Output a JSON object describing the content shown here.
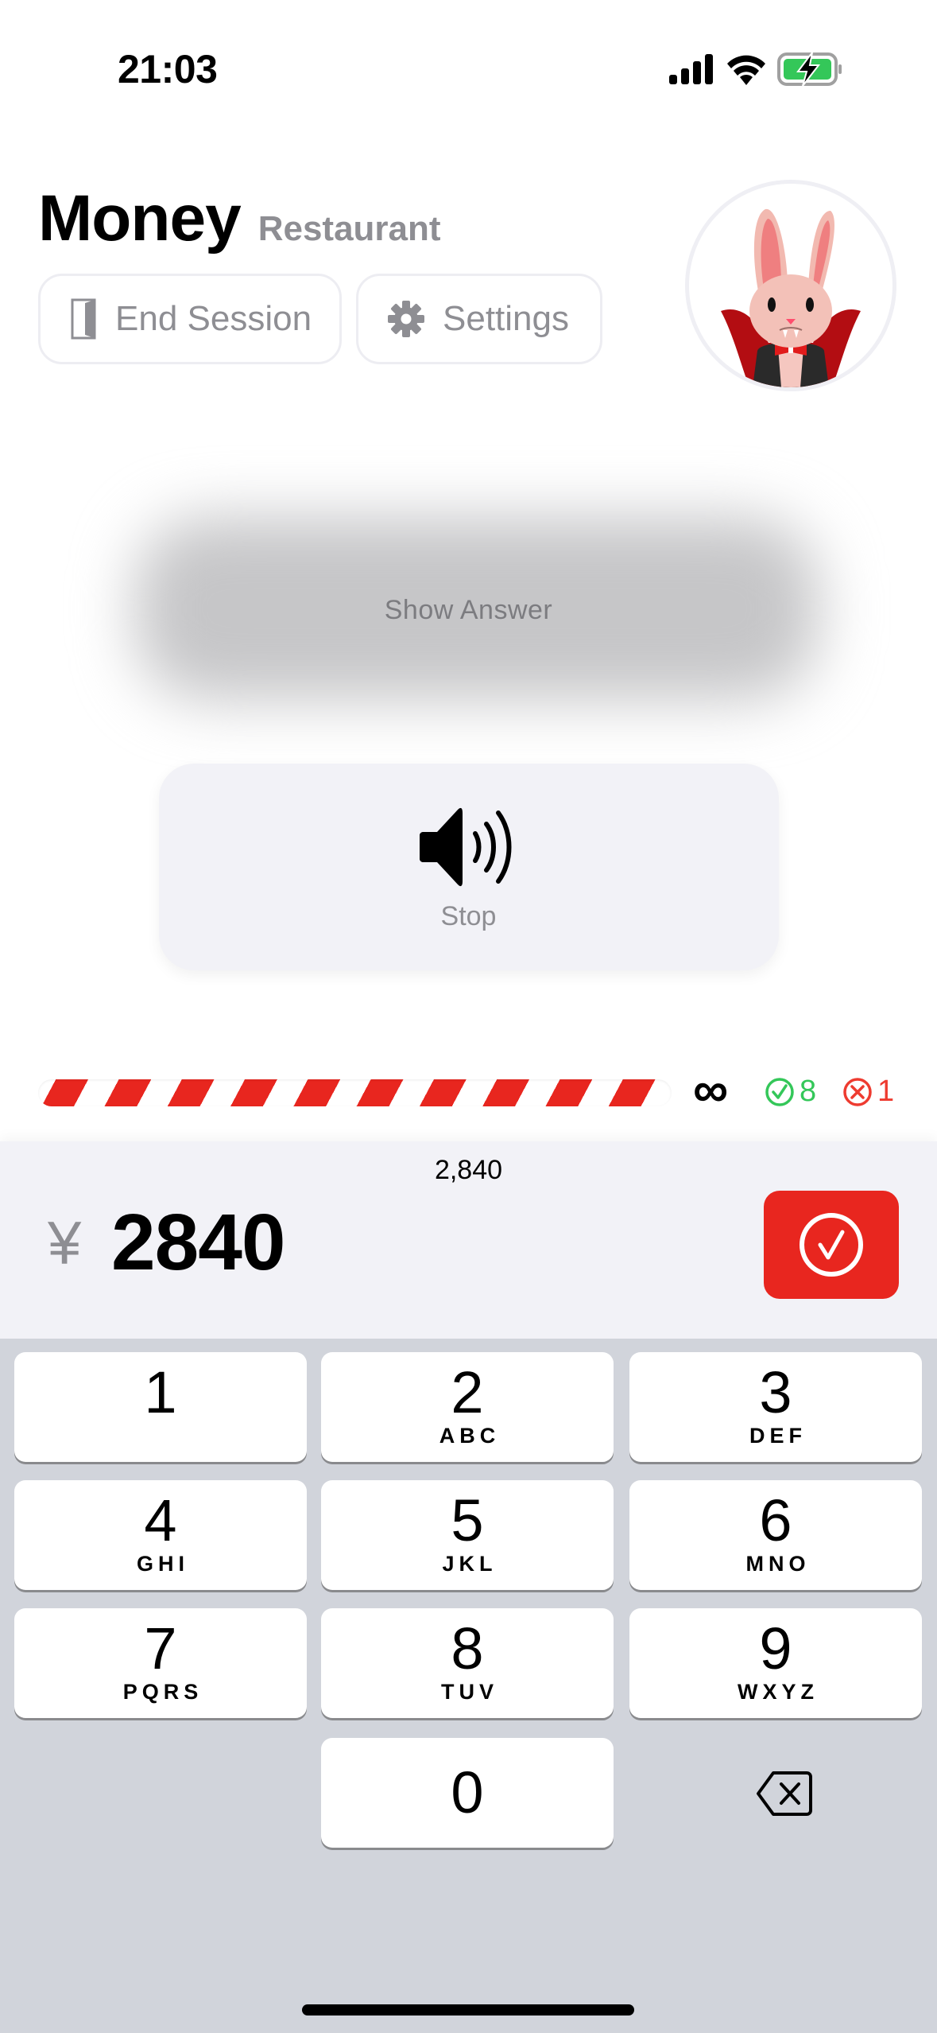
{
  "status_bar": {
    "time": "21:03",
    "battery_color": "#34c759"
  },
  "header": {
    "title": "Money",
    "subtitle": "Restaurant",
    "end_session_label": "End Session",
    "settings_label": "Settings",
    "avatar": "vampire-bunny-avatar"
  },
  "answer": {
    "show_answer_label": "Show Answer"
  },
  "audio": {
    "stop_label": "Stop",
    "icon": "speaker-wave-icon"
  },
  "progress": {
    "fraction": 1.0,
    "remaining": "∞",
    "correct_count": "8",
    "wrong_count": "1",
    "colors": {
      "stripe": "#e8261f",
      "correct": "#34c759",
      "wrong": "#ee3b30"
    }
  },
  "input": {
    "formatted_value": "2,840",
    "currency_symbol": "¥",
    "value": "2840",
    "confirm_color": "#e8261f"
  },
  "keypad": {
    "keys": [
      {
        "num": "1",
        "letters": ""
      },
      {
        "num": "2",
        "letters": "ABC"
      },
      {
        "num": "3",
        "letters": "DEF"
      },
      {
        "num": "4",
        "letters": "GHI"
      },
      {
        "num": "5",
        "letters": "JKL"
      },
      {
        "num": "6",
        "letters": "MNO"
      },
      {
        "num": "7",
        "letters": "PQRS"
      },
      {
        "num": "8",
        "letters": "TUV"
      },
      {
        "num": "9",
        "letters": "WXYZ"
      },
      {
        "num": "0",
        "letters": ""
      }
    ],
    "backspace_icon": "delete-left-icon"
  }
}
